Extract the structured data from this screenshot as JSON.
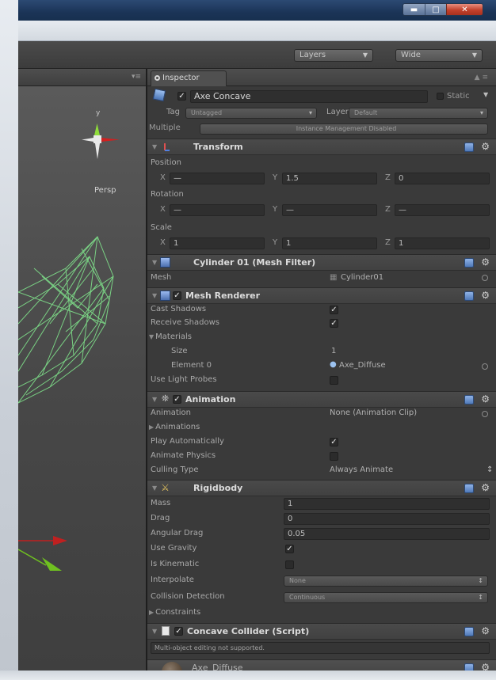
{
  "window": {
    "controls": [
      "minimize",
      "maximize",
      "close"
    ]
  },
  "toolbar": {
    "layers_label": "Layers",
    "layout_label": "Wide"
  },
  "scene": {
    "persp_label": "Persp",
    "gizmo_y_label": "y"
  },
  "inspector": {
    "tab_label": "Inspector",
    "object": {
      "name": "Axe Concave",
      "static_label": "Static",
      "tag_label": "Tag",
      "tag_value": "Untagged",
      "layer_label": "Layer",
      "layer_value": "Default",
      "multiple_label": "Multiple",
      "instance_management": "Instance Management Disabled"
    },
    "transform": {
      "title": "Transform",
      "position_label": "Position",
      "position": {
        "x": "—",
        "y": "1.5",
        "z": "0"
      },
      "rotation_label": "Rotation",
      "rotation": {
        "x": "—",
        "y": "—",
        "z": "—"
      },
      "scale_label": "Scale",
      "scale": {
        "x": "1",
        "y": "1",
        "z": "1"
      },
      "axis_x": "X",
      "axis_y": "Y",
      "axis_z": "Z"
    },
    "mesh_filter": {
      "title": "Cylinder 01 (Mesh Filter)",
      "mesh_label": "Mesh",
      "mesh_value": "Cylinder01"
    },
    "mesh_renderer": {
      "title": "Mesh Renderer",
      "enabled": true,
      "cast_shadows_label": "Cast Shadows",
      "cast_shadows": true,
      "receive_shadows_label": "Receive Shadows",
      "receive_shadows": true,
      "materials_label": "Materials",
      "size_label": "Size",
      "size_value": "1",
      "element0_label": "Element 0",
      "element0_value": "Axe_Diffuse",
      "light_probes_label": "Use Light Probes",
      "light_probes": false
    },
    "animation": {
      "title": "Animation",
      "enabled": true,
      "animation_label": "Animation",
      "animation_value": "None (Animation Clip)",
      "animations_label": "Animations",
      "play_auto_label": "Play Automatically",
      "play_auto": true,
      "animate_physics_label": "Animate Physics",
      "animate_physics": false,
      "culling_label": "Culling Type",
      "culling_value": "Always Animate"
    },
    "rigidbody": {
      "title": "Rigidbody",
      "mass_label": "Mass",
      "mass_value": "1",
      "drag_label": "Drag",
      "drag_value": "0",
      "angular_drag_label": "Angular Drag",
      "angular_drag_value": "0.05",
      "use_gravity_label": "Use Gravity",
      "use_gravity": true,
      "is_kinematic_label": "Is Kinematic",
      "is_kinematic": false,
      "interpolate_label": "Interpolate",
      "interpolate_value": "None",
      "collision_label": "Collision Detection",
      "collision_value": "Continuous",
      "constraints_label": "Constraints"
    },
    "concave_collider": {
      "title": "Concave Collider (Script)",
      "enabled": true,
      "message": "Multi-object editing not supported."
    },
    "material": {
      "name": "Axe_Diffuse"
    }
  },
  "colors": {
    "wireframe": "#7fe08a",
    "gizmo_x": "#e02020",
    "gizmo_y": "#7ed321",
    "inspector_bg": "#3a3a3a"
  }
}
